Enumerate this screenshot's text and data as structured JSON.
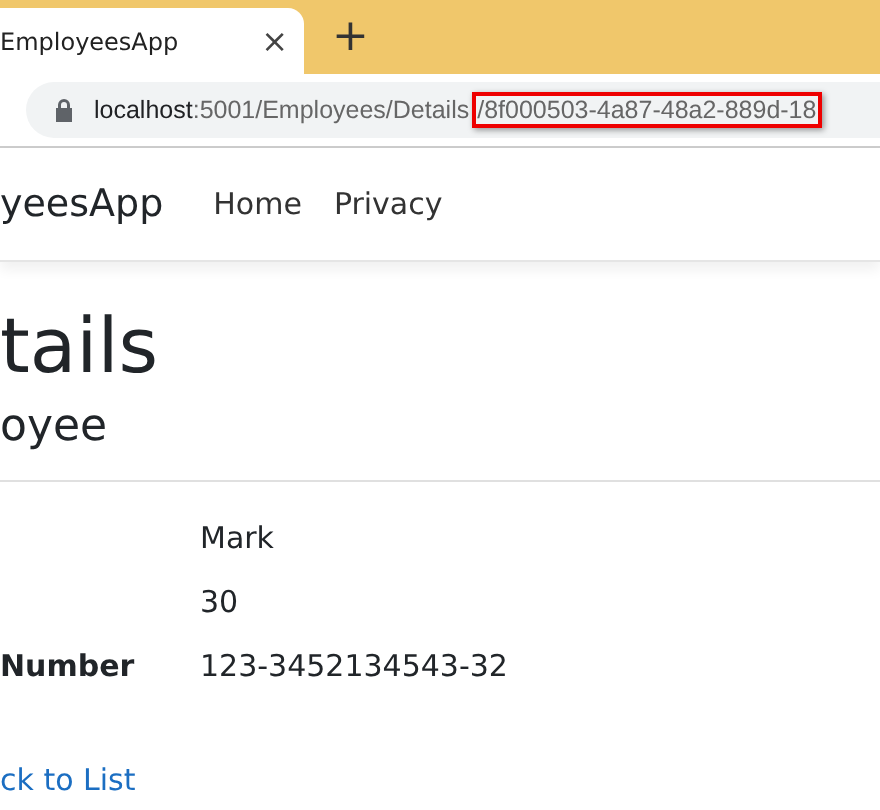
{
  "browser": {
    "tab": {
      "title": "EmployeesApp",
      "close": "×"
    },
    "new_tab": "+",
    "address": {
      "host": "localhost",
      "path": ":5001/Employees/Details",
      "highlighted": "/8f000503-4a87-48a2-889d-18"
    }
  },
  "navbar": {
    "brand": "yeesApp",
    "links": [
      "Home",
      "Privacy"
    ]
  },
  "heading": "tails",
  "subheading": "oyee",
  "details": [
    {
      "value": "Mark"
    },
    {
      "value": "30"
    },
    {
      "label": "Number",
      "value": "123-3452134543-32"
    }
  ],
  "back_link": "ck to List"
}
